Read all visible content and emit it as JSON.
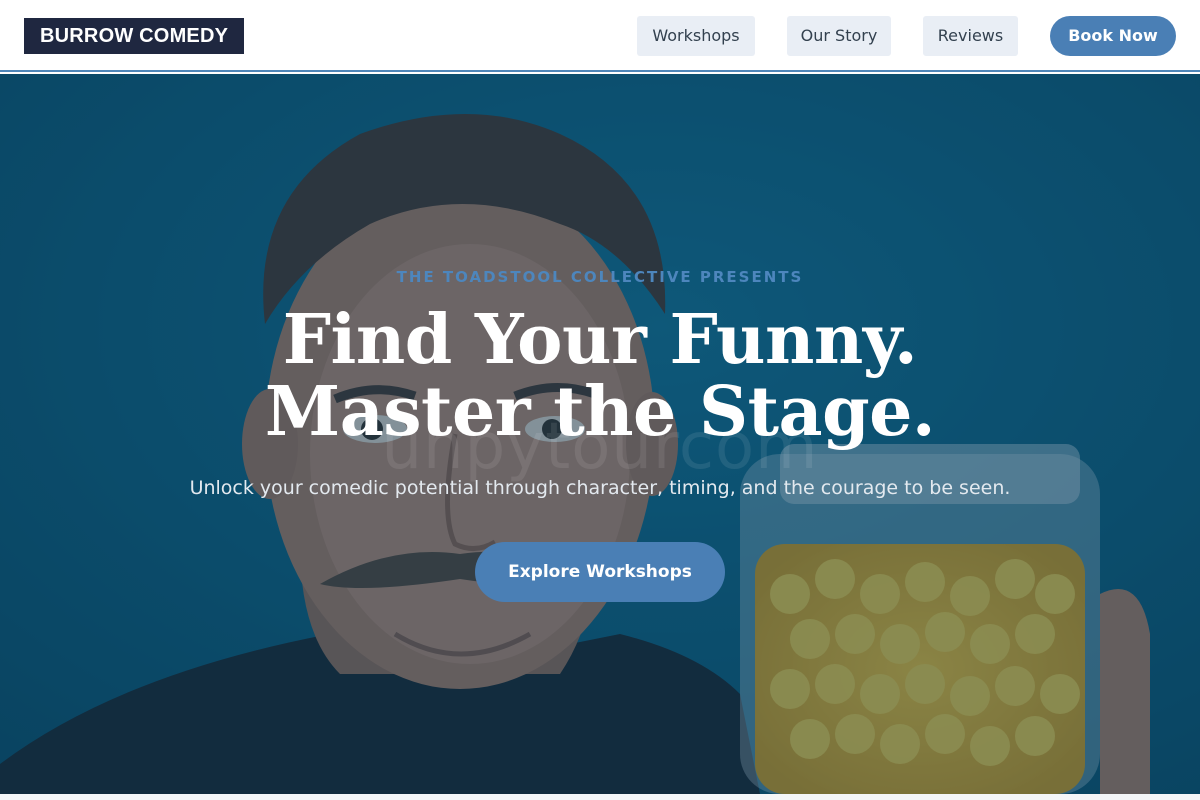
{
  "header": {
    "logo": "BURROW COMEDY",
    "nav": [
      {
        "label": "Workshops"
      },
      {
        "label": "Our Story"
      },
      {
        "label": "Reviews"
      }
    ],
    "cta_label": "Book Now"
  },
  "hero": {
    "eyebrow": "THE TOADSTOOL COLLECTIVE PRESENTS",
    "headline": "Find Your Funny. Master the Stage.",
    "subtitle": "Unlock your comedic potential through character, timing, and the courage to be seen.",
    "cta_label": "Explore Workshops",
    "watermark": "unpytourcom"
  },
  "colors": {
    "accent": "#4a7fb5",
    "logo_bg": "#1f2740",
    "hero_bg": "#0c5f7e",
    "eyebrow": "#4d86bd"
  }
}
